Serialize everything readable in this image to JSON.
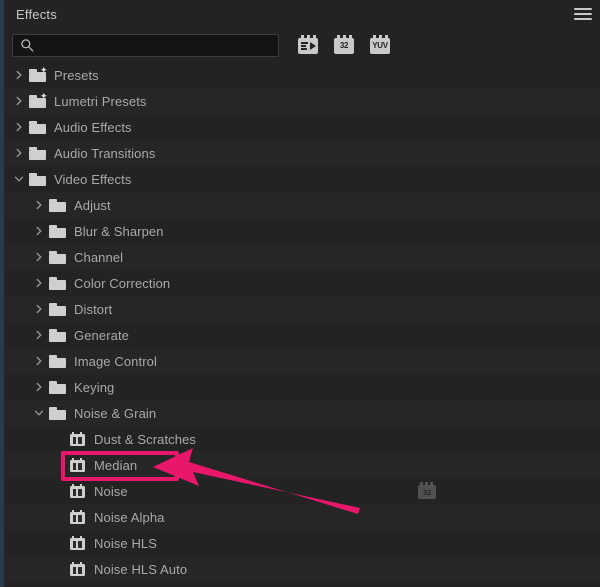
{
  "panel": {
    "title": "Effects",
    "menu_icon": "hamburger-menu-icon"
  },
  "search": {
    "value": "",
    "placeholder": "",
    "icon": "search-icon"
  },
  "filters": [
    {
      "name": "accelerated-effects-filter",
      "icon": "chip-play-icon",
      "label": ""
    },
    {
      "name": "32-bit-color-filter",
      "icon": "chip-32-icon",
      "label": "32"
    },
    {
      "name": "yuv-color-filter",
      "icon": "chip-yuv-icon",
      "label": "YUV"
    }
  ],
  "tree": {
    "rows": [
      {
        "label": "Presets",
        "indent": 0,
        "type": "folder-preset",
        "state": "collapsed"
      },
      {
        "label": "Lumetri Presets",
        "indent": 0,
        "type": "folder-preset",
        "state": "collapsed"
      },
      {
        "label": "Audio Effects",
        "indent": 0,
        "type": "folder",
        "state": "collapsed"
      },
      {
        "label": "Audio Transitions",
        "indent": 0,
        "type": "folder",
        "state": "collapsed"
      },
      {
        "label": "Video Effects",
        "indent": 0,
        "type": "folder",
        "state": "expanded"
      },
      {
        "label": "Adjust",
        "indent": 1,
        "type": "folder",
        "state": "collapsed"
      },
      {
        "label": "Blur & Sharpen",
        "indent": 1,
        "type": "folder",
        "state": "collapsed"
      },
      {
        "label": "Channel",
        "indent": 1,
        "type": "folder",
        "state": "collapsed"
      },
      {
        "label": "Color Correction",
        "indent": 1,
        "type": "folder",
        "state": "collapsed"
      },
      {
        "label": "Distort",
        "indent": 1,
        "type": "folder",
        "state": "collapsed"
      },
      {
        "label": "Generate",
        "indent": 1,
        "type": "folder",
        "state": "collapsed"
      },
      {
        "label": "Image Control",
        "indent": 1,
        "type": "folder",
        "state": "collapsed"
      },
      {
        "label": "Keying",
        "indent": 1,
        "type": "folder",
        "state": "collapsed"
      },
      {
        "label": "Noise & Grain",
        "indent": 1,
        "type": "folder",
        "state": "expanded"
      },
      {
        "label": "Dust & Scratches",
        "indent": 2,
        "type": "effect",
        "state": "leaf"
      },
      {
        "label": "Median",
        "indent": 2,
        "type": "effect",
        "state": "leaf",
        "highlighted": true
      },
      {
        "label": "Noise",
        "indent": 2,
        "type": "effect",
        "state": "leaf",
        "badge": "32"
      },
      {
        "label": "Noise Alpha",
        "indent": 2,
        "type": "effect",
        "state": "leaf"
      },
      {
        "label": "Noise HLS",
        "indent": 2,
        "type": "effect",
        "state": "leaf"
      },
      {
        "label": "Noise HLS Auto",
        "indent": 2,
        "type": "effect",
        "state": "leaf"
      }
    ]
  },
  "annotations": {
    "highlight_color": "#e8176c",
    "highlight_target": "Median",
    "arrow_color": "#e8176c"
  }
}
